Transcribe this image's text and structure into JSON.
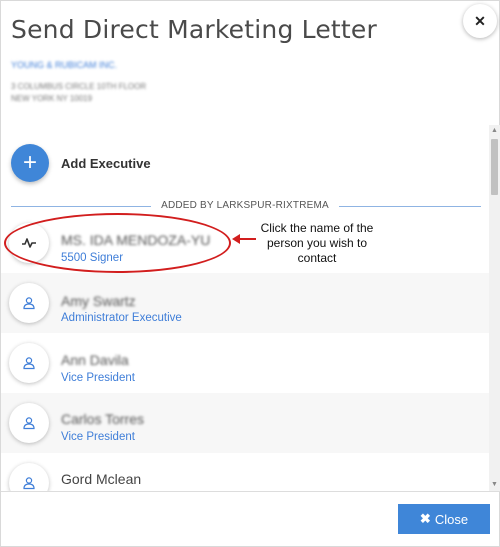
{
  "dialog": {
    "title": "Send Direct Marketing Letter",
    "close_icon_glyph": "✕"
  },
  "company": {
    "name": "YOUNG & RUBICAM INC.",
    "address_line1": "3 COLUMBUS CIRCLE 10TH FLOOR",
    "address_line2": "NEW YORK NY 10019"
  },
  "add_executive": {
    "icon_glyph": "+",
    "label": "Add Executive"
  },
  "section": {
    "label": "ADDED BY LARKSPUR-RIXTREMA"
  },
  "contacts": [
    {
      "name": "MS. IDA MENDOZA-YU",
      "role": "5500 Signer",
      "icon": "signature-icon"
    },
    {
      "name": "Amy Swartz",
      "role": "Administrator Executive",
      "icon": "user-icon"
    },
    {
      "name": "Ann Davila",
      "role": "Vice President",
      "icon": "user-icon"
    },
    {
      "name": "Carlos Torres",
      "role": "Vice President",
      "icon": "user-icon"
    },
    {
      "name": "Gord Mclean",
      "role": "",
      "icon": "user-icon"
    }
  ],
  "annotation": {
    "text": "Click the name of the person you wish to contact",
    "color": "#d21e1e"
  },
  "footer": {
    "close_glyph": "✖",
    "close_label": "Close"
  },
  "colors": {
    "accent": "#3f86d8",
    "link": "#3f7ed8",
    "annotation": "#d21e1e"
  }
}
